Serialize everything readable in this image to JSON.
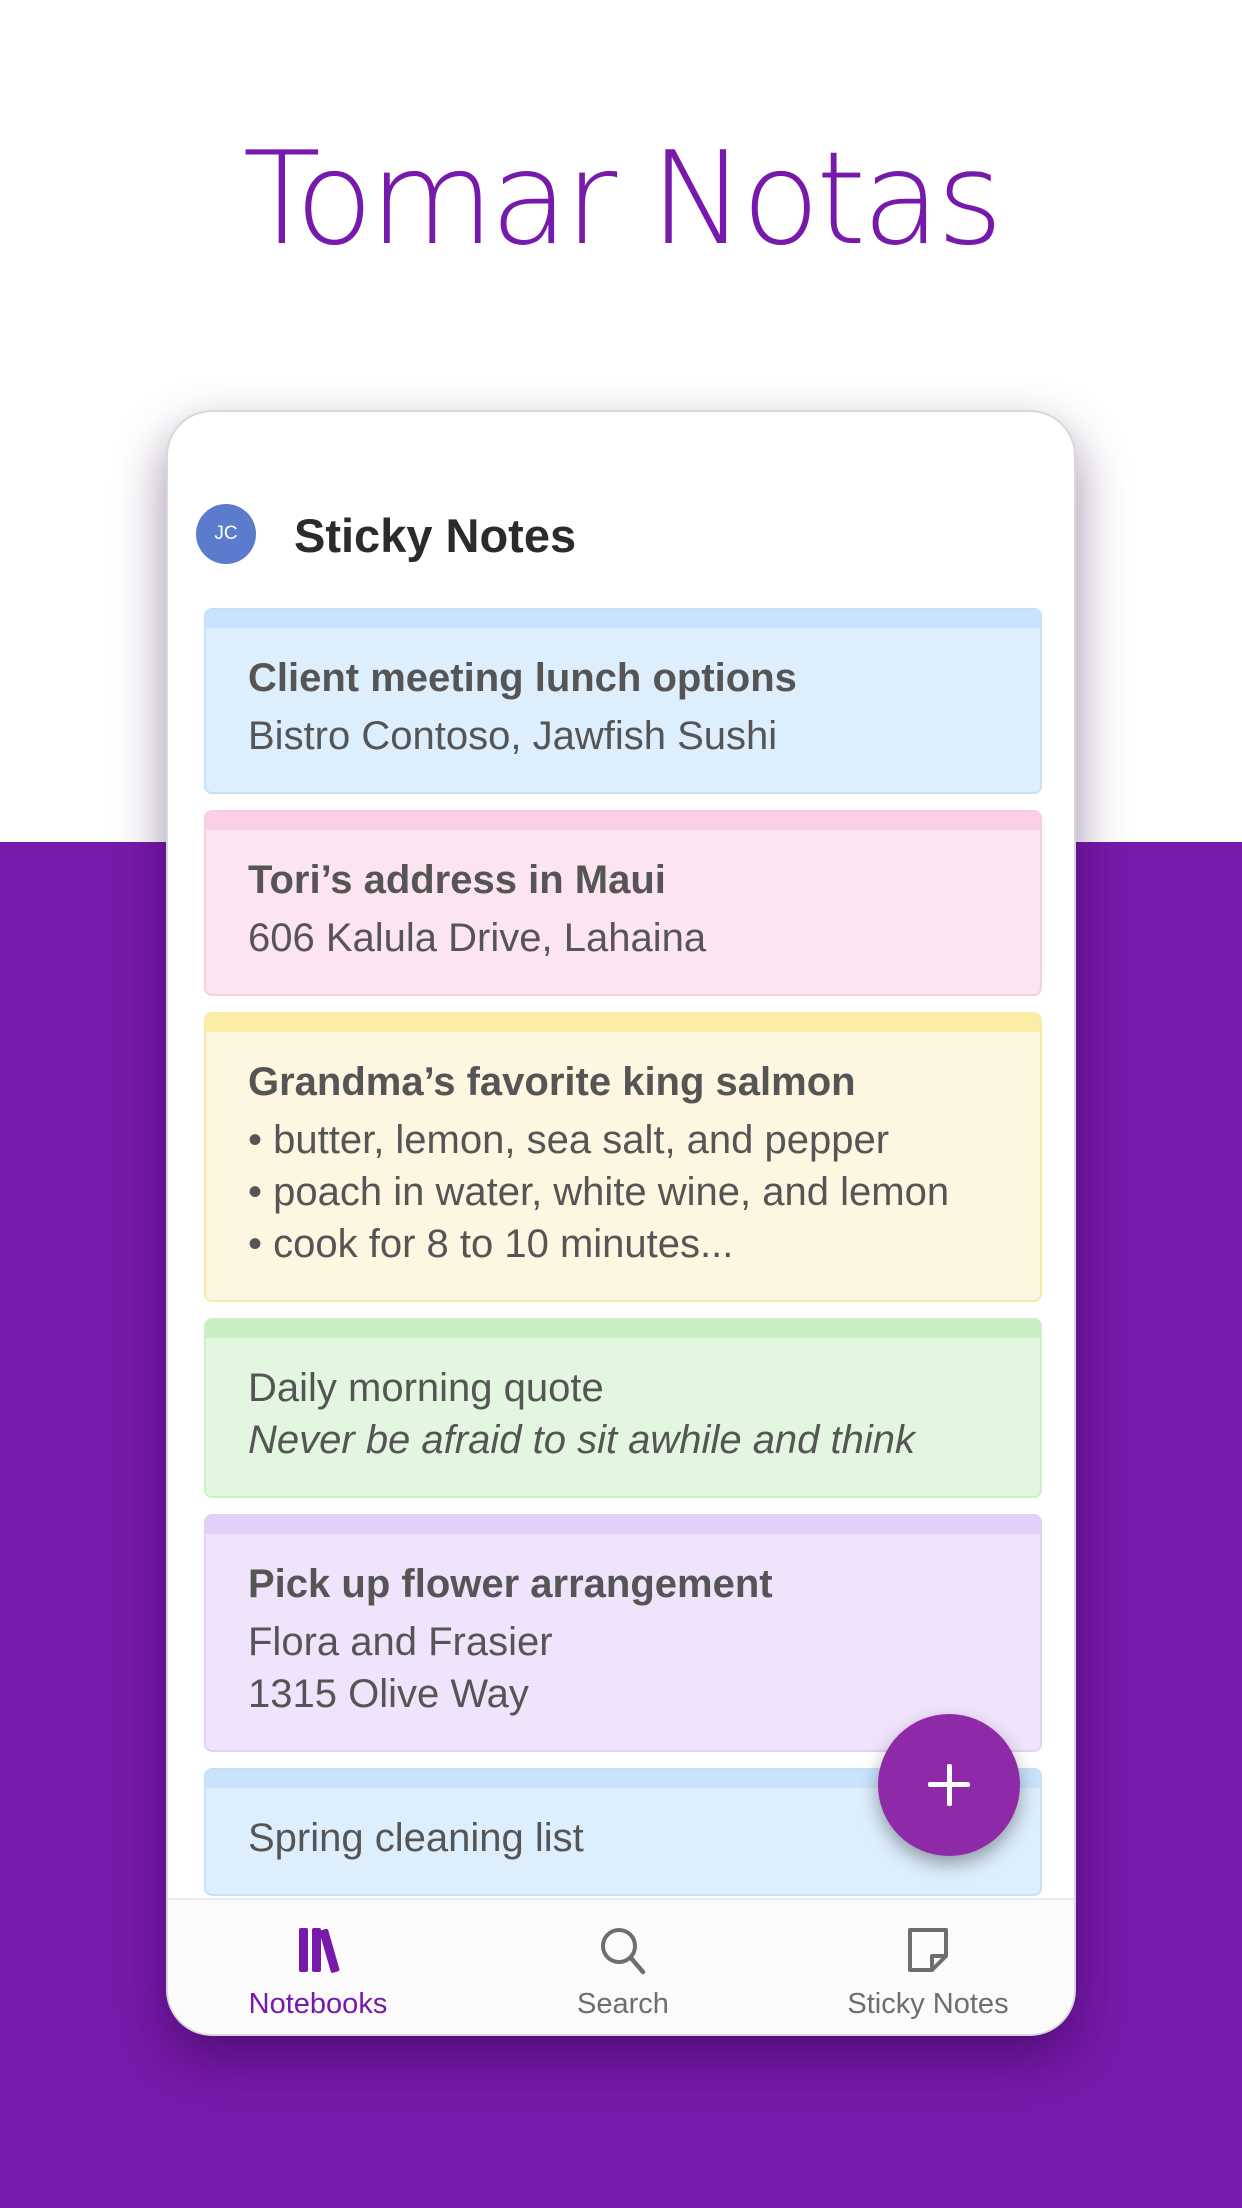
{
  "hero": {
    "title": "Tomar Notas"
  },
  "app": {
    "avatar_initials": "JC",
    "title": "Sticky Notes"
  },
  "notes": [
    {
      "color": "blue",
      "lines": [
        {
          "text": "Client meeting lunch options",
          "style": "bold"
        },
        {
          "text": "Bistro Contoso, Jawfish Sushi",
          "style": "normal"
        }
      ]
    },
    {
      "color": "pink",
      "lines": [
        {
          "text": "Tori’s address in Maui",
          "style": "bold"
        },
        {
          "text": "606 Kalula Drive, Lahaina",
          "style": "normal"
        }
      ]
    },
    {
      "color": "yellow",
      "lines": [
        {
          "text": "Grandma’s favorite king salmon",
          "style": "bold"
        },
        {
          "text": "• butter, lemon, sea salt, and pepper",
          "style": "normal"
        },
        {
          "text": "• poach in water, white wine, and lemon",
          "style": "normal"
        },
        {
          "text": "• cook for 8 to 10 minutes...",
          "style": "normal"
        }
      ]
    },
    {
      "color": "green",
      "lines": [
        {
          "text": "Daily morning quote",
          "style": "normal"
        },
        {
          "text": "Never be afraid to sit awhile and think",
          "style": "italic"
        }
      ]
    },
    {
      "color": "purple",
      "lines": [
        {
          "text": "Pick up flower arrangement",
          "style": "bold"
        },
        {
          "text": "Flora and Frasier",
          "style": "normal"
        },
        {
          "text": "1315 Olive Way",
          "style": "normal"
        }
      ]
    },
    {
      "color": "blue",
      "lines": [
        {
          "text": "Spring cleaning list",
          "style": "normal"
        }
      ]
    }
  ],
  "note_colors": {
    "blue": {
      "bg": "#ddeefd",
      "strip": "#c8e3fb",
      "border": "#c6e0f9"
    },
    "pink": {
      "bg": "#fde4f1",
      "strip": "#fbcfe5",
      "border": "#f8cde3"
    },
    "yellow": {
      "bg": "#fdf6e0",
      "strip": "#fbeca6",
      "border": "#f6e9a9"
    },
    "green": {
      "bg": "#e3f7e0",
      "strip": "#c9eec3",
      "border": "#cdeec8"
    },
    "purple": {
      "bg": "#f0e4fd",
      "strip": "#e2cffa",
      "border": "#e2d0f7"
    }
  },
  "fab": {
    "icon": "plus-icon"
  },
  "tabs": [
    {
      "label": "Notebooks",
      "icon": "notebooks-icon",
      "active": true
    },
    {
      "label": "Search",
      "icon": "search-icon",
      "active": false
    },
    {
      "label": "Sticky Notes",
      "icon": "sticky-note-icon",
      "active": false
    }
  ],
  "colors": {
    "brand": "#7719aa",
    "tab_active": "#7719aa",
    "tab_inactive": "#6e6e6e"
  }
}
